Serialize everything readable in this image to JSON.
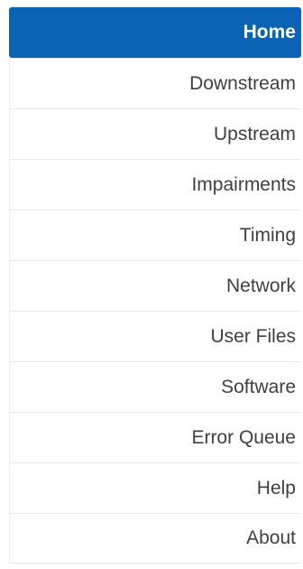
{
  "accent_color": "#0a63b5",
  "nav": {
    "items": [
      {
        "label": "Home",
        "active": true
      },
      {
        "label": "Downstream"
      },
      {
        "label": "Upstream"
      },
      {
        "label": "Impairments"
      },
      {
        "label": "Timing"
      },
      {
        "label": "Network"
      },
      {
        "label": "User Files"
      },
      {
        "label": "Software"
      },
      {
        "label": "Error Queue"
      },
      {
        "label": "Help"
      },
      {
        "label": "About"
      }
    ]
  }
}
